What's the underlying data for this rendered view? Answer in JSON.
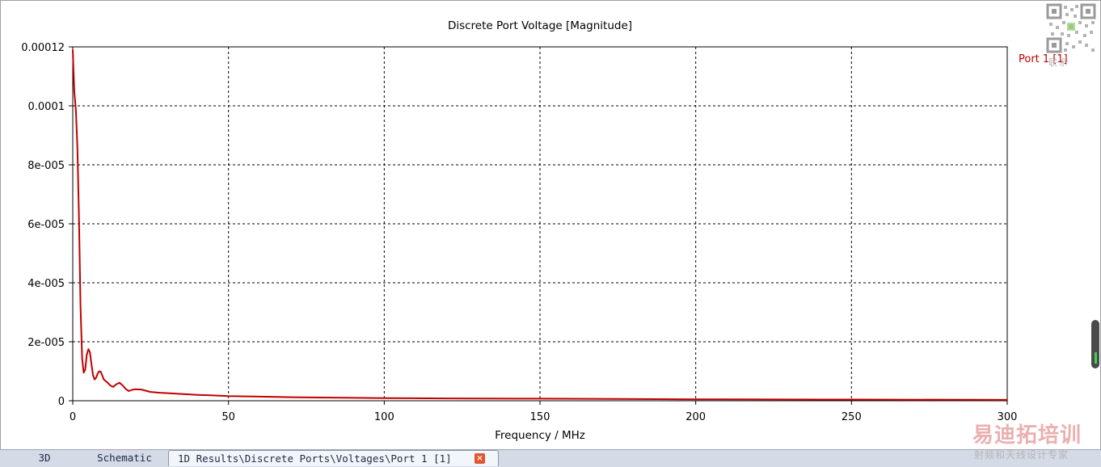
{
  "chart_data": {
    "type": "line",
    "title": "Discrete Port Voltage [Magnitude]",
    "xlabel": "Frequency / MHz",
    "ylabel": "",
    "xlim": [
      0,
      300
    ],
    "ylim": [
      0,
      0.00012
    ],
    "x_ticks": [
      0,
      50,
      100,
      150,
      200,
      250,
      300
    ],
    "x_tick_labels": [
      "0",
      "50",
      "100",
      "150",
      "200",
      "250",
      "300"
    ],
    "y_ticks": [
      0,
      2e-05,
      4e-05,
      6e-05,
      8e-05,
      0.0001,
      0.00012
    ],
    "y_tick_labels": [
      "0",
      "2e-005",
      "4e-005",
      "6e-005",
      "8e-005",
      "0.0001",
      "0.00012"
    ],
    "grid": true,
    "legend_position": "top-right",
    "series": [
      {
        "name": "Port 1 [1]",
        "color": "#c00000",
        "x": [
          0,
          0.2,
          0.5,
          1,
          1.5,
          2,
          2.5,
          3,
          3.5,
          4,
          4.5,
          5,
          5.5,
          6,
          6.5,
          7,
          7.5,
          8,
          8.5,
          9,
          9.5,
          10,
          10.5,
          11,
          11.5,
          12,
          13,
          14,
          15,
          16,
          17,
          18,
          19,
          20,
          22,
          25,
          28,
          30,
          35,
          40,
          45,
          50,
          60,
          70,
          80,
          100,
          120,
          150,
          200,
          250,
          300
        ],
        "y": [
          0.000119,
          0.000113,
          0.000105,
          9.85e-05,
          8.55e-05,
          6.2e-05,
          3.2e-05,
          1.45e-05,
          9.5e-06,
          1.05e-05,
          1.55e-05,
          1.75e-05,
          1.65e-05,
          1.25e-05,
          8.8e-06,
          7.2e-06,
          7.8e-06,
          9.2e-06,
          1e-05,
          9.8e-06,
          8.5e-06,
          7.2e-06,
          6.7e-06,
          6.3e-06,
          5.8e-06,
          5.2e-06,
          4.7e-06,
          5.6e-06,
          6.1e-06,
          5.2e-06,
          4e-06,
          3.3e-06,
          3.7e-06,
          3.9e-06,
          3.8e-06,
          3e-06,
          2.7e-06,
          2.6e-06,
          2.3e-06,
          2e-06,
          1.8e-06,
          1.6e-06,
          1.4e-06,
          1.2e-06,
          1.1e-06,
          9e-07,
          8e-07,
          7e-07,
          5e-07,
          4e-07,
          3e-07
        ]
      }
    ]
  },
  "tabs": {
    "tab_3d": "3D",
    "tab_schematic": "Schematic",
    "tab_active": "1D Results\\Discrete Ports\\Voltages\\Port 1 [1]",
    "tab_close": "×"
  },
  "overlay": {
    "qr_caption": "联系",
    "watermark_main": "易迪拓培训",
    "watermark_sub": "射频和天线设计专家"
  }
}
